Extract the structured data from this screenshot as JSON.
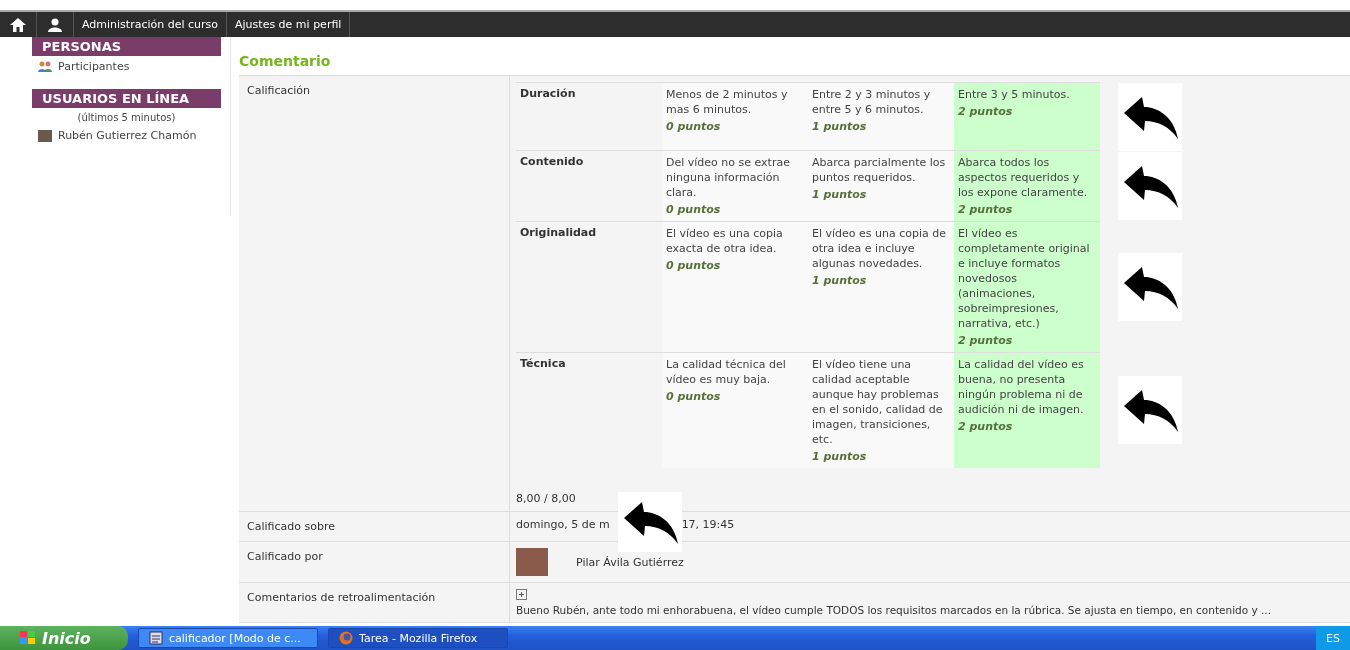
{
  "navbar": {
    "links": [
      {
        "label": "Administración del curso"
      },
      {
        "label": "Ajustes de mi perfil"
      }
    ]
  },
  "sidebar": [
    {
      "title": "PERSONAS",
      "items": [
        {
          "kind": "participants",
          "text": "Participantes"
        }
      ]
    },
    {
      "title": "USUARIOS EN LÍNEA",
      "note": "(últimos 5 minutos)",
      "items": [
        {
          "kind": "user",
          "text": "Rubén Gutierrez Chamón"
        }
      ]
    }
  ],
  "heading": "Comentario",
  "rows": [
    {
      "kind": "rubric",
      "label": "Calificación",
      "criteria": [
        {
          "name": "Duración",
          "levels": [
            {
              "description": "Menos de 2 minutos y mas 6 minutos.",
              "points": "0 puntos",
              "selected": false
            },
            {
              "description": "Entre 2 y 3 minutos y entre 5 y 6 minutos.",
              "points": "1 puntos",
              "selected": false
            },
            {
              "description": "Entre 3 y 5 minutos.",
              "points": "2 puntos",
              "selected": true
            }
          ]
        },
        {
          "name": "Contenido",
          "levels": [
            {
              "description": "Del vídeo no se extrae ninguna información clara.",
              "points": "0 puntos",
              "selected": false
            },
            {
              "description": "Abarca parcialmente los puntos requeridos.",
              "points": "1 puntos",
              "selected": false
            },
            {
              "description": "Abarca todos los aspectos requeridos y los expone claramente.",
              "points": "2 puntos",
              "selected": true
            }
          ]
        },
        {
          "name": "Originalidad",
          "levels": [
            {
              "description": "El vídeo es una copia exacta de otra idea.",
              "points": "0 puntos",
              "selected": false
            },
            {
              "description": "El vídeo es una copia de otra idea e incluye algunas novedades.",
              "points": "1 puntos",
              "selected": false
            },
            {
              "description": "El vídeo es completamente original e incluye formatos novedosos (animaciones, sobreimpresiones, narrativa, etc.)",
              "points": "2 puntos",
              "selected": true
            }
          ]
        },
        {
          "name": "Técnica",
          "levels": [
            {
              "description": "La calidad técnica del vídeo es muy baja.",
              "points": "0 puntos",
              "selected": false
            },
            {
              "description": "El vídeo tiene una calidad aceptable aunque hay problemas en el sonido, calidad de imagen, transiciones, etc.",
              "points": "1 puntos",
              "selected": false
            },
            {
              "description": "La calidad del vídeo es buena, no presenta ningún problema ni de audición ni de imagen.",
              "points": "2 puntos",
              "selected": true
            }
          ]
        }
      ],
      "total": "8,00 / 8,00"
    },
    {
      "kind": "date",
      "label": "Calificado sobre",
      "parts": [
        "domingo, 5 de m",
        "17, 19:45"
      ]
    },
    {
      "kind": "user",
      "label": "Calificado por",
      "name": "Pilar Ávila Gutiérrez"
    },
    {
      "kind": "feedback",
      "label": "Comentarios de retroalimentación",
      "text": "Bueno Rubén, ante todo mi enhorabuena, el vídeo cumple TODOS los requisitos marcados en la rúbrica. Se ajusta en tiempo, en contenido y ..."
    }
  ],
  "taskbar": {
    "start": "Inicio",
    "tasks": [
      {
        "kind": "document",
        "label": "calificador [Modo de c...",
        "selected": false
      },
      {
        "kind": "browser",
        "label": "Tarea - Mozilla Firefox",
        "selected": true
      }
    ],
    "language": "ES"
  }
}
